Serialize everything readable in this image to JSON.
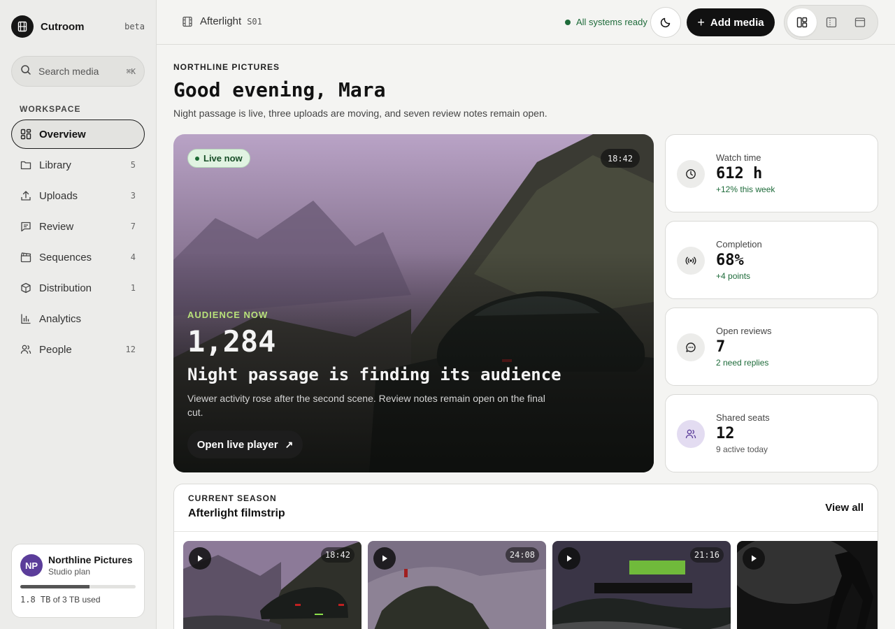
{
  "app": {
    "name": "Cutroom",
    "tag": "beta"
  },
  "search": {
    "placeholder": "Search media",
    "shortcut": "⌘K"
  },
  "sidebar": {
    "section_label": "WORKSPACE",
    "items": [
      {
        "label": "Overview",
        "count": "",
        "icon": "grid-icon",
        "active": true
      },
      {
        "label": "Library",
        "count": "5",
        "icon": "folder-icon"
      },
      {
        "label": "Uploads",
        "count": "3",
        "icon": "upload-icon"
      },
      {
        "label": "Review",
        "count": "7",
        "icon": "comment-icon"
      },
      {
        "label": "Sequences",
        "count": "4",
        "icon": "clapper-icon"
      },
      {
        "label": "Distribution",
        "count": "1",
        "icon": "package-icon"
      },
      {
        "label": "Analytics",
        "count": "",
        "icon": "bar-chart-icon"
      },
      {
        "label": "People",
        "count": "12",
        "icon": "people-icon"
      }
    ]
  },
  "plan": {
    "avatar": "NP",
    "name": "Northline Pictures",
    "tier": "Studio plan",
    "usage_used": "1.8 TB",
    "usage_rest": "of 3 TB used",
    "usage_fraction": 0.6
  },
  "topbar": {
    "project": "Afterlight",
    "season_code": "S01",
    "status": "All systems ready",
    "add_label": "Add media",
    "status_color": "#1e6b3a"
  },
  "header": {
    "eyebrow": "NORTHLINE PICTURES",
    "greeting": "Good evening, Mara",
    "summary": "Night passage is live, three uploads are moving, and seven review notes remain open."
  },
  "hero": {
    "badge": "Live now",
    "duration": "18:42",
    "eyebrow": "AUDIENCE NOW",
    "number": "1,284",
    "title": "Night passage is finding its audience",
    "description": "Viewer activity rose after the second scene. Review notes remain open on the final cut.",
    "button": "Open live player"
  },
  "stats": [
    {
      "label": "Watch time",
      "value": "612 h",
      "note": "+12% this week",
      "icon": "clock-icon"
    },
    {
      "label": "Completion",
      "value": "68%",
      "note": "+4 points",
      "icon": "broadcast-icon"
    },
    {
      "label": "Open reviews",
      "value": "7",
      "note": "2 need replies",
      "icon": "chat-icon"
    },
    {
      "label": "Shared seats",
      "value": "12",
      "note": "9 active today",
      "icon": "people-icon"
    }
  ],
  "season": {
    "eyebrow": "CURRENT SEASON",
    "title": "Afterlight filmstrip",
    "view_all": "View all",
    "episodes": [
      {
        "duration": "18:42"
      },
      {
        "duration": "24:08"
      },
      {
        "duration": "21:16"
      },
      {
        "duration": ""
      }
    ]
  }
}
